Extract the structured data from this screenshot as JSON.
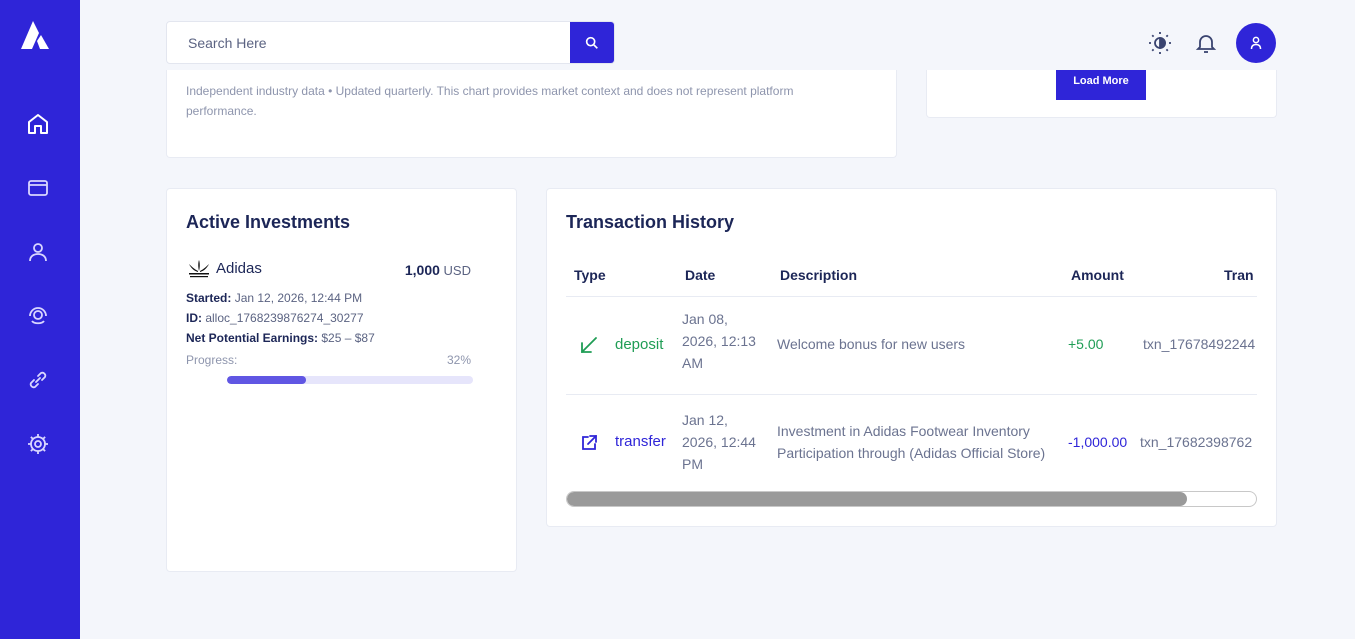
{
  "sidebar": {
    "nav": [
      {
        "name": "home-icon"
      },
      {
        "name": "wallet-icon"
      },
      {
        "name": "user-icon"
      },
      {
        "name": "support-icon"
      },
      {
        "name": "link-icon"
      },
      {
        "name": "gear-icon"
      }
    ]
  },
  "header": {
    "search_placeholder": "Search Here"
  },
  "market_card": {
    "disclaimer": "Independent industry data • Updated quarterly. This chart provides market context and does not represent platform performance."
  },
  "side_card": {
    "button_label": "Load More"
  },
  "investments": {
    "title": "Active Investments",
    "items": [
      {
        "brand": "Adidas",
        "amount": "1,000",
        "currency": "USD",
        "started_label": "Started:",
        "started": "Jan 12, 2026, 12:44 PM",
        "id_label": "ID:",
        "id": "alloc_1768239876274_30277",
        "earnings_label": "Net Potential Earnings:",
        "earnings": "$25 – $87",
        "progress_label": "Progress:",
        "progress_text": "32%",
        "progress": 0.32
      }
    ]
  },
  "transactions": {
    "title": "Transaction History",
    "columns": [
      "Type",
      "Date",
      "Description",
      "Amount",
      "Tran"
    ],
    "rows": [
      {
        "type": "deposit",
        "type_color": "#1f9d55",
        "date_line1": "Jan 08,",
        "date_line2": "2026, 12:13",
        "date_line3": "AM",
        "desc_line1": "Welcome bonus for new users",
        "desc_line2": "",
        "amount": "+5.00",
        "amount_color": "#1f9d55",
        "txn": "txn_17678492244"
      },
      {
        "type": "transfer",
        "type_color": "#2f25d8",
        "date_line1": "Jan 12,",
        "date_line2": "2026, 12:44",
        "date_line3": "PM",
        "desc_line1": "Investment in Adidas Footwear Inventory",
        "desc_line2": "Participation through (Adidas Official Store)",
        "amount": "-1,000.00",
        "amount_color": "#2f25d8",
        "txn": "txn_17682398762"
      }
    ]
  },
  "colors": {
    "brand": "#2f25d8",
    "background": "#f4f6fb",
    "progress_fill": "#6056e3",
    "progress_track": "#e6e5fb"
  }
}
